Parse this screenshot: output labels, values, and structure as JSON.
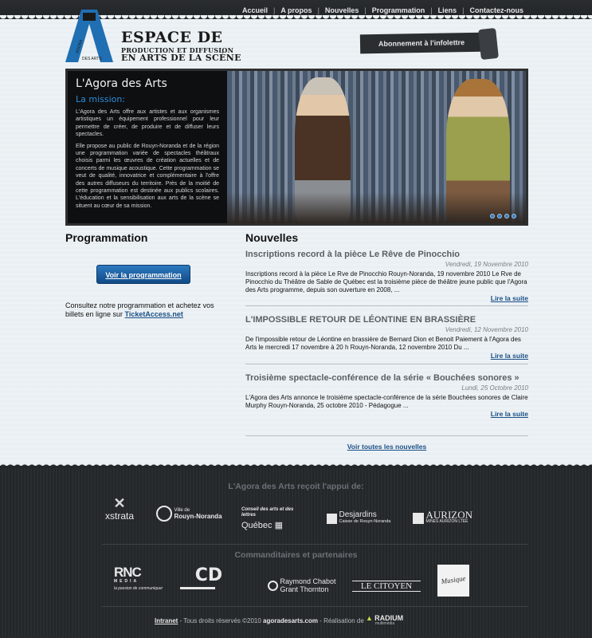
{
  "nav": [
    "Accueil",
    "A propos",
    "Nouvelles",
    "Programmation",
    "Liens",
    "Contactez-nous"
  ],
  "nav_sep": "|",
  "logo": {
    "line1": "ESPACE DE",
    "line2": "PRODUCTION ET DIFFUSION",
    "line3": "EN ARTS DE LA SCÈNE",
    "mark_a": "AGORA",
    "mark_b": "DES ARTS"
  },
  "subscribe_label": "Abonnement à l'infolettre",
  "hero": {
    "title": "L'Agora des Arts",
    "subtitle": "La mission:",
    "para1": "L'Agora des Arts offre aux artistes et aux organismes artistiques un équipement professionnel pour leur permettre de créer, de produire et de diffuser leurs spectacles.",
    "para2": "Elle propose au public de Rouyn-Noranda et de la région une programmation variée de spectacles théâtraux choisis parmi les œuvres de création actuelles et de concerts de musique acoustique. Cette programmation se veut de qualité, innovatrice et complémentaire à l'offre des autres diffuseurs du territoire. Près de la moitié de cette programmation est destinée aux publics scolaires. L'éducation et la sensibilisation aux arts de la scène se situent au cœur de sa mission."
  },
  "programmation": {
    "heading": "Programmation",
    "button": "Voir la programmation",
    "note_text": "Consultez notre programmation et achetez vos billets en ligne sur ",
    "note_link": "TicketAccess.net"
  },
  "news": {
    "heading": "Nouvelles",
    "items": [
      {
        "title": "Inscriptions record à la pièce Le Rêve de Pinocchio",
        "date": "Vendredi, 19 Novembre 2010",
        "text": "Inscriptions record à la pièce Le Rve de Pinocchio Rouyn-Noranda, 19 novembre 2010 Le Rve de Pinocchio du Théâtre de Sable de Québec est la troisième pièce de théâtre jeune public que l'Agora des Arts programme, depuis son ouverture en 2008, ...",
        "more": "Lire la suite"
      },
      {
        "title": "L'IMPOSSIBLE RETOUR DE LÉONTINE EN BRASSIÈRE",
        "date": "Vendredi, 12 Novembre 2010",
        "text": "De l'impossible retour de Léontine en brassière de Bernard Dion et Benoit Paiement à l'Agora des Arts le mercredi 17 novembre à 20 h Rouyn-Noranda, 12 novembre 2010 Du ...",
        "more": "Lire la suite"
      },
      {
        "title": "Troisième spectacle-conférence de la série « Bouchées sonores »",
        "date": "Lundi, 25 Octobre 2010",
        "text": "L'Agora des Arts annonce le troisième spectacle-conférence de la série Bouchées sonores de Claire Murphy Rouyn-Noranda, 25 octobre 2010 - Pédagogue ...",
        "more": "Lire la suite"
      }
    ],
    "all_link": "Voir toutes les nouvelles"
  },
  "footer": {
    "support_title": "L'Agora des Arts reçoit l'appui de:",
    "support_logos": [
      "xstrata",
      "Ville de",
      "Rouyn-Noranda",
      "Conseil des arts et des lettres",
      "Québec",
      "Desjardins",
      "Caisse de Rouyn-Noranda",
      "AURIZON",
      "MINES AURIZON LTÉE"
    ],
    "partners_title": "Commanditaires et partenaires",
    "partner_logos": [
      "RNC",
      "MEDIA",
      "la passion de communiquer",
      "CD",
      "Raymond Chabot",
      "Grant Thornton",
      "LE CITOYEN",
      "Musique"
    ],
    "copyright_link": "Intranet",
    "copyright_text": " - Tous droits réservés ©2010 ",
    "copyright_site": "agoradesarts.com",
    "copyright_credit": " - Réalisation de ",
    "credit_logo": "RADIUM",
    "credit_sub": "multimédia"
  }
}
